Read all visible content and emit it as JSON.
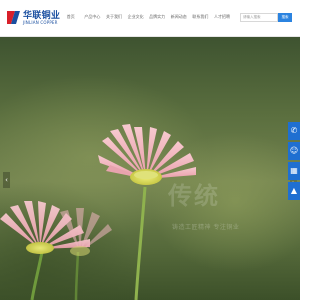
{
  "brand": {
    "name_cn": "华联铜业",
    "name_en": "JINLIAN COPPER"
  },
  "nav": {
    "items": [
      {
        "label": "首页"
      },
      {
        "label": "产品中心"
      },
      {
        "label": "关于我们"
      },
      {
        "label": "企业文化"
      },
      {
        "label": "品牌实力"
      },
      {
        "label": "新闻动态"
      },
      {
        "label": "联系我们"
      },
      {
        "label": "人才招聘"
      }
    ]
  },
  "search": {
    "placeholder": "请输入搜索",
    "button_label": "搜索"
  },
  "banner": {
    "slogan_big": "传统",
    "slogan_small": "铸造工匠精神 专注铜业"
  },
  "side_toolbar": {
    "items": [
      {
        "icon": "phone-icon",
        "glyph": "✆"
      },
      {
        "icon": "qq-icon",
        "glyph": "☺"
      },
      {
        "icon": "qrcode-icon",
        "glyph": "▦"
      },
      {
        "icon": "back-to-top-icon",
        "glyph": "▲"
      }
    ]
  },
  "colors": {
    "accent": "#2b83e0",
    "brand_blue": "#1a4fa0",
    "brand_red": "#d8202a",
    "toolbar": "#1f6fd1"
  }
}
